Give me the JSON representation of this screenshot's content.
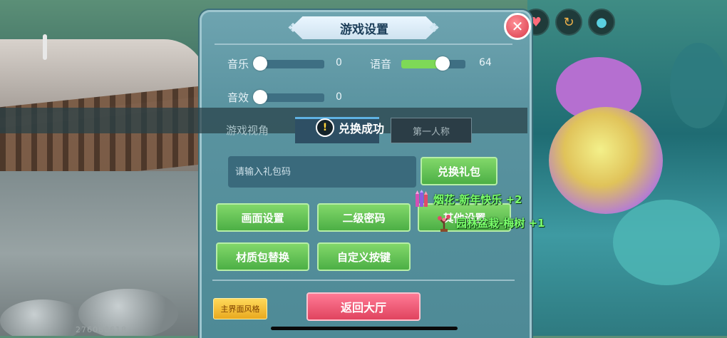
{
  "dialog": {
    "title": "游戏设置",
    "close_symbol": "✕"
  },
  "audio": {
    "music": {
      "label": "音乐",
      "value": "0",
      "level": 0
    },
    "voice": {
      "label": "语音",
      "value": "64",
      "level": 0.64
    },
    "sfx": {
      "label": "音效",
      "value": "0",
      "level": 0
    }
  },
  "view": {
    "label": "游戏视角",
    "options": [
      "",
      "第一人称"
    ],
    "toast": "兑换成功",
    "toast_icon": "!"
  },
  "gift": {
    "placeholder": "请输入礼包码",
    "button": "兑换礼包"
  },
  "buttons": {
    "graphics": "画面设置",
    "second_password": "二级密码",
    "other": "其他设置",
    "texture_pack": "材质包替换",
    "custom_keys": "自定义按键",
    "ui_style": "主界面风格",
    "back_lobby": "返回大厅"
  },
  "rewards": [
    {
      "text": "烟花-新年快乐 +2",
      "icon": "firework-icon"
    },
    {
      "text": "园林盆栽-梅树 +1",
      "icon": "plum-tree-icon"
    }
  ],
  "watermark": "276080618",
  "colors": {
    "accent_green": "#7ed957",
    "button_red": "#e0445f",
    "reward_text": "#7bff6b"
  }
}
